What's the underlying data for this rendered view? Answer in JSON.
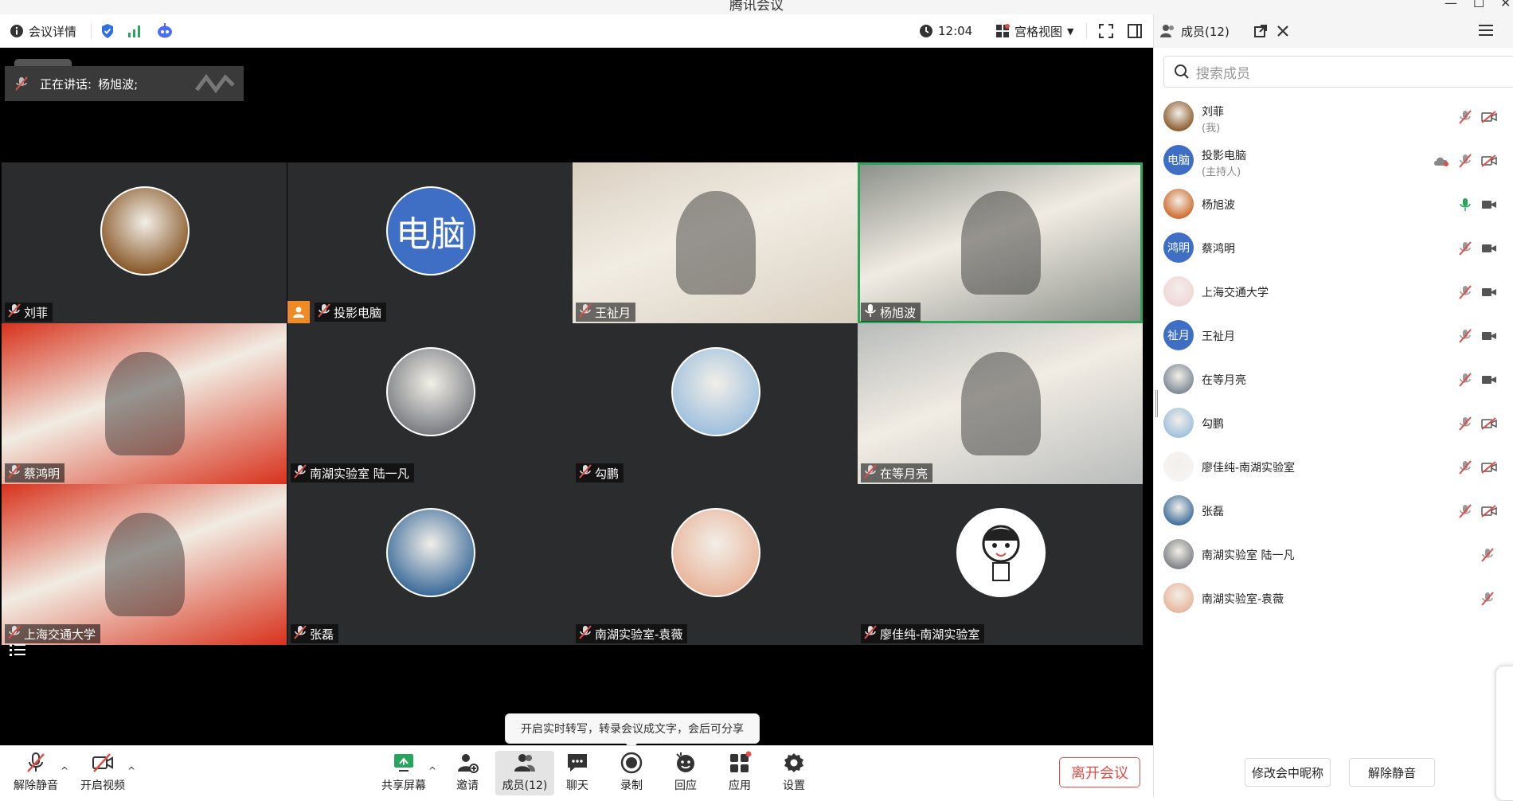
{
  "app": {
    "title": "腾讯会议",
    "window_buttons": [
      "—",
      "☐",
      "✕"
    ]
  },
  "topbar": {
    "meeting_details": "会议详情",
    "time": "12:04",
    "view_mode": "宫格视图"
  },
  "speaking": {
    "label": "正在讲话:",
    "name": "杨旭波;"
  },
  "tiles": [
    {
      "name": "刘菲",
      "mic": "muted",
      "avatar_type": "photo",
      "avatar_color": "#8a5a2b"
    },
    {
      "name": "投影电脑",
      "mic": "muted",
      "avatar_type": "text",
      "avatar_text": "电脑",
      "avatar_color": "#3f6fc4",
      "host": true
    },
    {
      "name": "王祉月",
      "mic": "muted",
      "avatar_type": "video",
      "avatar_color": "#d9cfc0"
    },
    {
      "name": "杨旭波",
      "mic": "on",
      "avatar_type": "video",
      "avatar_color": "#8a8f88",
      "active": true
    },
    {
      "name": "蔡鸿明",
      "mic": "muted",
      "avatar_type": "video",
      "avatar_color": "#d8321c"
    },
    {
      "name": "南湖实验室 陆一凡",
      "mic": "muted",
      "avatar_type": "photo",
      "avatar_color": "#7c7f84"
    },
    {
      "name": "勾鹏",
      "mic": "muted",
      "avatar_type": "photo",
      "avatar_color": "#9fc0de"
    },
    {
      "name": "在等月亮",
      "mic": "muted",
      "avatar_type": "video",
      "avatar_color": "#b9bcbc"
    },
    {
      "name": "上海交通大学",
      "mic": "muted",
      "avatar_type": "video",
      "avatar_color": "#d8321c"
    },
    {
      "name": "张磊",
      "mic": "muted",
      "avatar_type": "photo",
      "avatar_color": "#3e6d9c"
    },
    {
      "name": "南湖实验室-袁薇",
      "mic": "muted",
      "avatar_type": "photo",
      "avatar_color": "#e9b59c"
    },
    {
      "name": "廖佳纯-南湖实验室",
      "mic": "muted",
      "avatar_type": "cartoon",
      "avatar_color": "#ffffff"
    }
  ],
  "toolbar": {
    "unmute": "解除静音",
    "video": "开启视频",
    "share": "共享屏幕",
    "invite": "邀请",
    "members": "成员(12)",
    "chat": "聊天",
    "record": "录制",
    "reactions": "回应",
    "apps": "应用",
    "settings": "设置",
    "leave": "离开会议"
  },
  "tooltip": {
    "transcribe": "开启实时转写，转录会议成文字，会后可分享"
  },
  "panel": {
    "title": "成员(12)",
    "search_placeholder": "搜索成员",
    "members": [
      {
        "name": "刘菲",
        "sub": "(我)",
        "av_text": "",
        "av_color": "#8a5a2b",
        "mic": "muted",
        "cam": "off"
      },
      {
        "name": "投影电脑",
        "sub": "(主持人)",
        "av_text": "电脑",
        "av_color": "#3f6fc4",
        "mic": "muted",
        "cam": "off",
        "cloud": true
      },
      {
        "name": "杨旭波",
        "sub": "",
        "av_text": "",
        "av_color": "#d06a2a",
        "mic": "on",
        "cam": "on"
      },
      {
        "name": "蔡鸿明",
        "sub": "",
        "av_text": "鸿明",
        "av_color": "#3f6fc4",
        "mic": "muted",
        "cam": "on"
      },
      {
        "name": "上海交通大学",
        "sub": "",
        "av_text": "",
        "av_color": "#f2d6d6",
        "mic": "muted",
        "cam": "on"
      },
      {
        "name": "王祉月",
        "sub": "",
        "av_text": "祉月",
        "av_color": "#3f6fc4",
        "mic": "muted",
        "cam": "on"
      },
      {
        "name": "在等月亮",
        "sub": "",
        "av_text": "",
        "av_color": "#7b8794",
        "mic": "muted",
        "cam": "on"
      },
      {
        "name": "勾鹏",
        "sub": "",
        "av_text": "",
        "av_color": "#9fc0de",
        "mic": "muted",
        "cam": "off"
      },
      {
        "name": "廖佳纯-南湖实验室",
        "sub": "",
        "av_text": "",
        "av_color": "#f5f5f5",
        "mic": "muted",
        "cam": "off"
      },
      {
        "name": "张磊",
        "sub": "",
        "av_text": "",
        "av_color": "#3e6d9c",
        "mic": "muted",
        "cam": "off"
      },
      {
        "name": "南湖实验室 陆一凡",
        "sub": "",
        "av_text": "",
        "av_color": "#7c7f84",
        "mic": "muted",
        "cam": "none"
      },
      {
        "name": "南湖实验室-袁薇",
        "sub": "",
        "av_text": "",
        "av_color": "#e9b59c",
        "mic": "muted",
        "cam": "none"
      }
    ],
    "rename_button": "修改会中昵称",
    "unmute_all_button": "解除静音"
  }
}
